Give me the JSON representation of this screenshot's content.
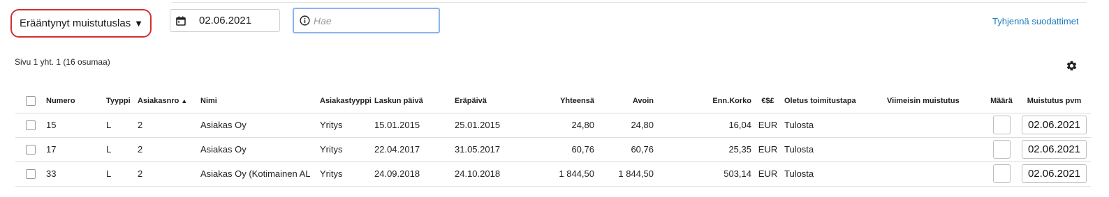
{
  "filters": {
    "select_value": "Erääntynyt muistutuslas…",
    "date_value": "02.06.2021",
    "search_placeholder": "Hae",
    "clear_link": "Tyhjennä suodattimet"
  },
  "pagination": {
    "info": "Sivu 1 yht. 1  (16 osumaa)"
  },
  "table": {
    "columns": {
      "numero": "Numero",
      "tyyppi": "Tyyppi",
      "asiakasnro": "Asiakasnro",
      "nimi": "Nimi",
      "asiakastyyppi": "Asiakastyyppi",
      "laskun_paiva": "Laskun päivä",
      "erapaiva": "Eräpäivä",
      "yhteensa": "Yhteensä",
      "avoin": "Avoin",
      "enn_korko": "Enn.Korko",
      "valuutta": "€$£",
      "oletus_toimitustapa": "Oletus toimitustapa",
      "viimeisin_muistutus": "Viimeisin muistutus",
      "maara": "Määrä",
      "muistutus_pvm": "Muistutus pvm"
    },
    "rows": [
      {
        "numero": "15",
        "tyyppi": "L",
        "asiakasnro": "2",
        "nimi": "Asiakas Oy",
        "asiakastyyppi": "Yritys",
        "laskun_paiva": "15.01.2015",
        "erapaiva": "25.01.2015",
        "yhteensa": "24,80",
        "avoin": "24,80",
        "enn_korko": "16,04",
        "valuutta": "EUR",
        "toimitustapa": "Tulosta",
        "viimeisin": "",
        "muistutus_pvm": "02.06.2021"
      },
      {
        "numero": "17",
        "tyyppi": "L",
        "asiakasnro": "2",
        "nimi": "Asiakas Oy",
        "asiakastyyppi": "Yritys",
        "laskun_paiva": "22.04.2017",
        "erapaiva": "31.05.2017",
        "yhteensa": "60,76",
        "avoin": "60,76",
        "enn_korko": "25,35",
        "valuutta": "EUR",
        "toimitustapa": "Tulosta",
        "viimeisin": "",
        "muistutus_pvm": "02.06.2021"
      },
      {
        "numero": "33",
        "tyyppi": "L",
        "asiakasnro": "2",
        "nimi": "Asiakas Oy (Kotimainen AL",
        "asiakastyyppi": "Yritys",
        "laskun_paiva": "24.09.2018",
        "erapaiva": "24.10.2018",
        "yhteensa": "1 844,50",
        "avoin": "1 844,50",
        "enn_korko": "503,14",
        "valuutta": "EUR",
        "toimitustapa": "Tulosta",
        "viimeisin": "",
        "muistutus_pvm": "02.06.2021"
      }
    ]
  },
  "colors": {
    "accent_link": "#1a7bbd",
    "select_outline": "#d32f2f",
    "search_focus": "#8ab4f0"
  },
  "icons": {
    "date": "calendar-icon",
    "search": "info-icon",
    "settings": "gear-icon",
    "sort": "chevron-up-icon",
    "select": "caret-down-icon"
  }
}
